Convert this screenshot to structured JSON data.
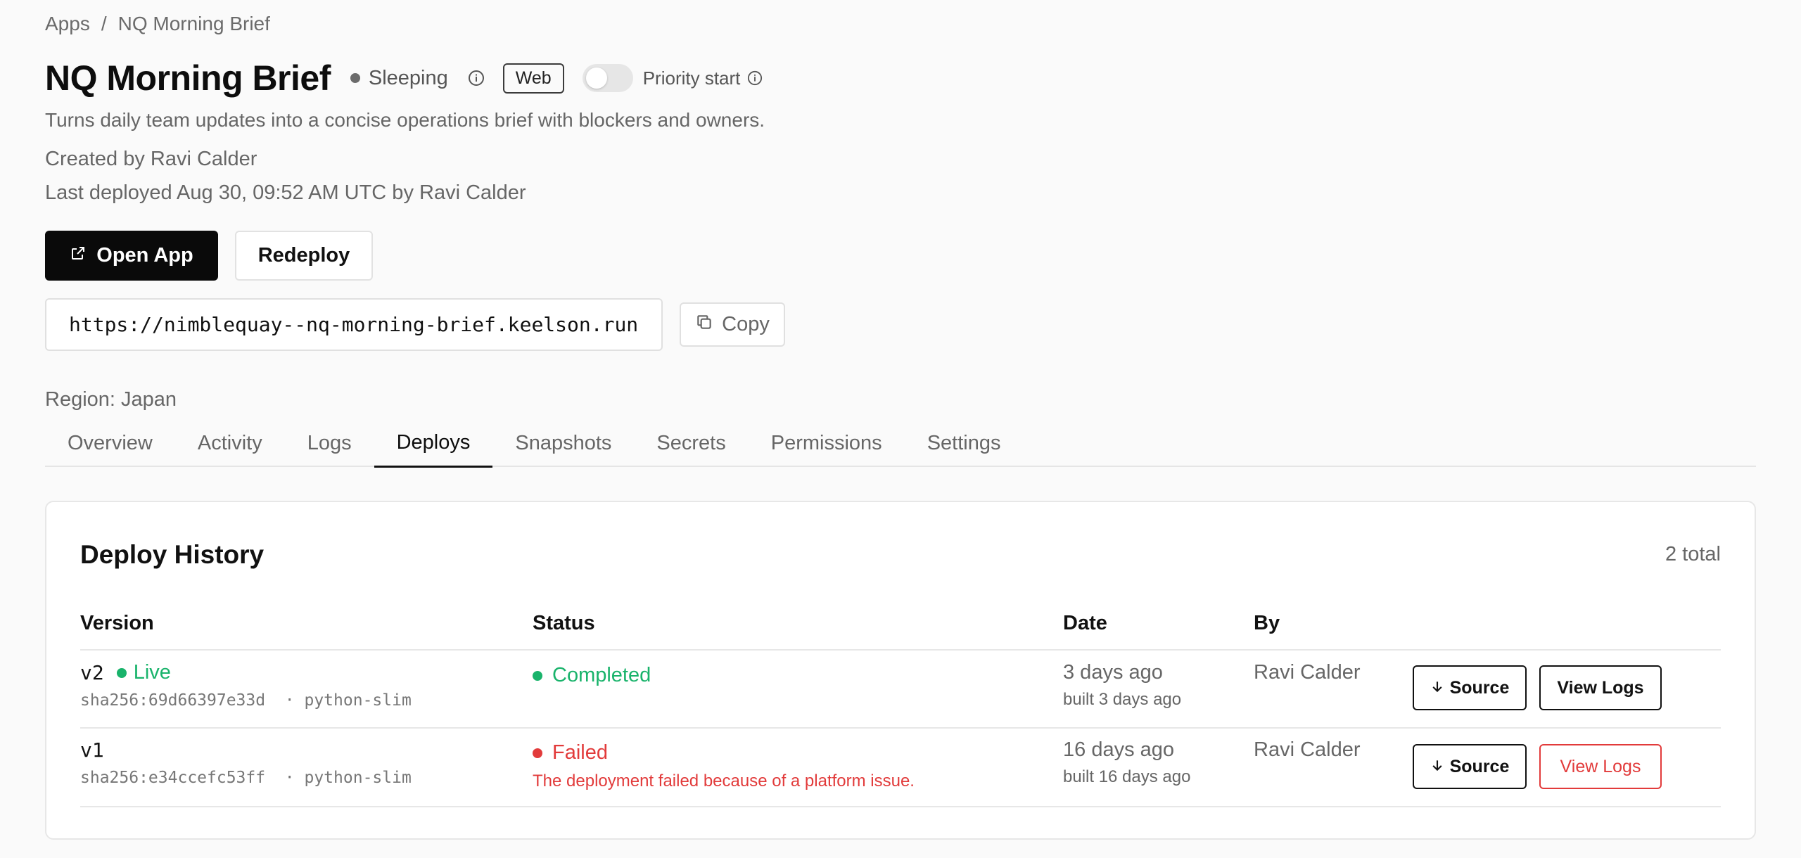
{
  "breadcrumb": {
    "root": "Apps",
    "separator": "/",
    "current": "NQ Morning Brief"
  },
  "app": {
    "title": "NQ Morning Brief",
    "status": "Sleeping",
    "badge": "Web",
    "priority_label": "Priority start",
    "priority_enabled": false,
    "description": "Turns daily team updates into a concise operations brief with blockers and owners.",
    "created_by": "Created by Ravi Calder",
    "last_deployed": "Last deployed Aug 30, 09:52 AM UTC by Ravi Calder",
    "region": "Region: Japan"
  },
  "actions": {
    "open_app": "Open App",
    "redeploy": "Redeploy",
    "copy": "Copy"
  },
  "url": "https://nimblequay--nq-morning-brief.keelson.run",
  "tabs": [
    {
      "label": "Overview"
    },
    {
      "label": "Activity"
    },
    {
      "label": "Logs"
    },
    {
      "label": "Deploys",
      "active": true
    },
    {
      "label": "Snapshots"
    },
    {
      "label": "Secrets"
    },
    {
      "label": "Permissions"
    },
    {
      "label": "Settings"
    }
  ],
  "deploy_history": {
    "title": "Deploy History",
    "count": "2 total",
    "columns": {
      "version": "Version",
      "status": "Status",
      "date": "Date",
      "by": "By"
    },
    "rows": [
      {
        "version": "v2",
        "live": "Live",
        "meta": "sha256:69d66397e33d  · python-slim",
        "status": "Completed",
        "status_kind": "ok",
        "error": "",
        "date": "3 days ago",
        "built": "built 3 days ago",
        "by": "Ravi Calder",
        "source_label": "Source",
        "logs_label": "View Logs"
      },
      {
        "version": "v1",
        "live": "",
        "meta": "sha256:e34ccefc53ff  · python-slim",
        "status": "Failed",
        "status_kind": "fail",
        "error": "The deployment failed because of a platform issue.",
        "date": "16 days ago",
        "built": "built 16 days ago",
        "by": "Ravi Calder",
        "source_label": "Source",
        "logs_label": "View Logs"
      }
    ]
  },
  "colors": {
    "success": "#19b36b",
    "danger": "#e23b3b",
    "primary": "#0a0a0a"
  },
  "icons": {
    "info": "info-icon",
    "external": "external-link-icon",
    "copy": "copy-icon",
    "download": "arrow-down-icon"
  }
}
